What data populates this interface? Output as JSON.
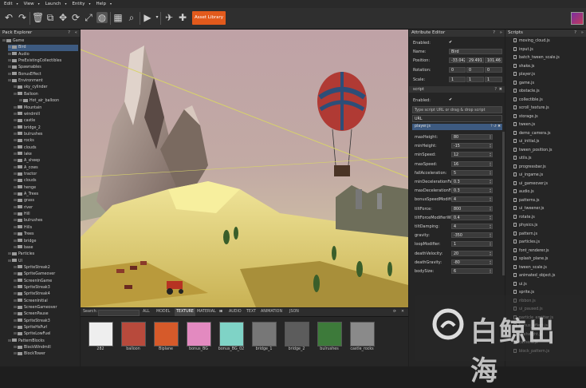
{
  "menu": [
    "Edit",
    "View",
    "Launch",
    "Entity",
    "Help"
  ],
  "toolbar": {
    "asset_library": "Asset Library"
  },
  "pack_explorer": {
    "title": "Pack Explorer",
    "items": [
      {
        "label": "Game",
        "depth": 0
      },
      {
        "label": "Bird",
        "depth": 1,
        "selected": true
      },
      {
        "label": "Audio",
        "depth": 1
      },
      {
        "label": "PreExistingCollectibles",
        "depth": 1
      },
      {
        "label": "Spawnables",
        "depth": 1
      },
      {
        "label": "BonusEffect",
        "depth": 1
      },
      {
        "label": "Environment",
        "depth": 1
      },
      {
        "label": "sky_cylinder",
        "depth": 2
      },
      {
        "label": "Balloon",
        "depth": 2
      },
      {
        "label": "Hot_air_balloon",
        "depth": 3
      },
      {
        "label": "Mountain",
        "depth": 2
      },
      {
        "label": "windmill",
        "depth": 2
      },
      {
        "label": "castle",
        "depth": 2
      },
      {
        "label": "bridge_2",
        "depth": 2
      },
      {
        "label": "bulrushes",
        "depth": 2
      },
      {
        "label": "rocks",
        "depth": 2
      },
      {
        "label": "clouds",
        "depth": 2
      },
      {
        "label": "lake",
        "depth": 2
      },
      {
        "label": "A_sheep",
        "depth": 2
      },
      {
        "label": "A_cows",
        "depth": 2
      },
      {
        "label": "tractor",
        "depth": 2
      },
      {
        "label": "clouds",
        "depth": 2
      },
      {
        "label": "henge",
        "depth": 2
      },
      {
        "label": "A_Trees",
        "depth": 2
      },
      {
        "label": "grass",
        "depth": 2
      },
      {
        "label": "river",
        "depth": 2
      },
      {
        "label": "Hill",
        "depth": 2
      },
      {
        "label": "bulrushes",
        "depth": 2
      },
      {
        "label": "Hills",
        "depth": 2
      },
      {
        "label": "Trees",
        "depth": 2
      },
      {
        "label": "bridge",
        "depth": 2
      },
      {
        "label": "base",
        "depth": 2
      },
      {
        "label": "Particles",
        "depth": 1
      },
      {
        "label": "UI",
        "depth": 1
      },
      {
        "label": "SpriteStreak2",
        "depth": 2
      },
      {
        "label": "SpriteGameover",
        "depth": 2
      },
      {
        "label": "ScreenInGame",
        "depth": 2
      },
      {
        "label": "SpriteStreak3",
        "depth": 2
      },
      {
        "label": "SpriteStreak4",
        "depth": 2
      },
      {
        "label": "ScreenInitial",
        "depth": 2
      },
      {
        "label": "ScreenGameover",
        "depth": 2
      },
      {
        "label": "ScreenPause",
        "depth": 2
      },
      {
        "label": "SpriteStreak3",
        "depth": 2
      },
      {
        "label": "SpriteHsPurl",
        "depth": 2
      },
      {
        "label": "SpriteLowFuel",
        "depth": 2
      },
      {
        "label": "PatternBlocks",
        "depth": 1
      },
      {
        "label": "BlockWindmill",
        "depth": 2
      },
      {
        "label": "BlockTower",
        "depth": 2
      }
    ]
  },
  "assets": {
    "search_label": "Search:",
    "tabs": [
      "ALL",
      "MODEL",
      "TEXTURE",
      "MATERIAL",
      "AUDIO",
      "TEXT",
      "ANIMATION",
      "JSON"
    ],
    "thumbs": [
      {
        "label": "282",
        "color": "#eeeeee"
      },
      {
        "label": "balloon",
        "color": "#b84a3c"
      },
      {
        "label": "Biplane",
        "color": "#d65a2a"
      },
      {
        "label": "bonus_BG",
        "color": "#e38ac0"
      },
      {
        "label": "bonus_BG_02",
        "color": "#7fd3c6"
      },
      {
        "label": "bridge_1",
        "color": "#777777"
      },
      {
        "label": "bridge_2",
        "color": "#5c5c5c"
      },
      {
        "label": "bulrushes",
        "color": "#3d7a3a"
      },
      {
        "label": "castle_rocks",
        "color": "#8a8a8a"
      }
    ]
  },
  "attribute_editor": {
    "title": "Attribute Editor",
    "enabled_label": "Enabled:",
    "name_label": "Name:",
    "name_value": "Bird",
    "position_label": "Position:",
    "position": [
      "-33.042",
      "29.491",
      "101.46"
    ],
    "rotation_label": "Rotation:",
    "rotation": [
      "0",
      "0",
      "0"
    ],
    "scale_label": "Scale:",
    "scale": [
      "1",
      "1",
      "1"
    ],
    "script_section": "script",
    "script_enabled_label": "Enabled:",
    "script_placeholder": "Type script URL or drag & drop script",
    "url_label": "URL",
    "script_file": "player.js",
    "fields": [
      {
        "label": "maxHeight:",
        "value": "80"
      },
      {
        "label": "minHeight:",
        "value": "-15"
      },
      {
        "label": "minSpeed:",
        "value": "12"
      },
      {
        "label": "maxSpeed:",
        "value": "16"
      },
      {
        "label": "fallAcceleration:",
        "value": "5"
      },
      {
        "label": "minDecelerationFact",
        "value": "0.3"
      },
      {
        "label": "maxDecelerationFact",
        "value": "0.3"
      },
      {
        "label": "bonusSpeedModifier",
        "value": "4"
      },
      {
        "label": "tiltForce:",
        "value": "800"
      },
      {
        "label": "tiltForceModifierWhe",
        "value": "0.4"
      },
      {
        "label": "tiltDamping:",
        "value": "4"
      },
      {
        "label": "gravity:",
        "value": "-350"
      },
      {
        "label": "loopModifier:",
        "value": "1"
      },
      {
        "label": "deathVelocity:",
        "value": "20"
      },
      {
        "label": "deathGravity:",
        "value": "-80"
      },
      {
        "label": "bodySize:",
        "value": "6"
      }
    ]
  },
  "scripts": {
    "title": "Scripts",
    "items": [
      "moving_cloud.js",
      "input.js",
      "batch_tween_scale.js",
      "shake.js",
      "player.js",
      "game.js",
      "obstacle.js",
      "collectible.js",
      "scroll_texture.js",
      "storage.js",
      "tween.js",
      "demo_camera.js",
      "ui_initial.js",
      "tween_position.js",
      "utils.js",
      "progressbar.js",
      "ui_ingame.js",
      "ui_gameover.js",
      "audio.js",
      "patterns.js",
      "ui_tweener.js",
      "rotate.js",
      "physics.js",
      "pattern.js",
      "particles.js",
      "font_renderer.js",
      "splash_plane.js",
      "tween_scale.js",
      "animated_object.js",
      "ui.js",
      "sprite.js",
      "ribbon.js",
      "ui_paused.js",
      "particle_emitter.js",
      "bonus_effect.js",
      "exeheight.js",
      "camera.js",
      "block_pattern.js"
    ]
  },
  "watermark": "白鲸出海",
  "colors": {
    "accent": "#e25a1c",
    "selection": "#3d5a80"
  }
}
